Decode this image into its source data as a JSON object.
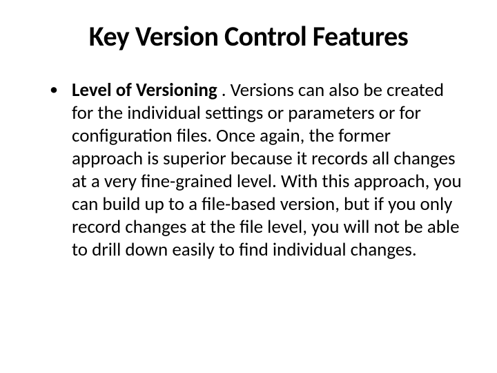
{
  "slide": {
    "title": "Key Version Control Features",
    "bullet": {
      "lead": " Level  of Versioning ",
      "body": ". Versions can also be created for the individual settings or parameters or for configuration files. Once again, the former approach is superior because it records all changes at a very fine-grained level. With this approach, you can build up to a file-based version, but if you only record changes at the file level, you will not be able to drill down easily to find individual changes."
    }
  }
}
